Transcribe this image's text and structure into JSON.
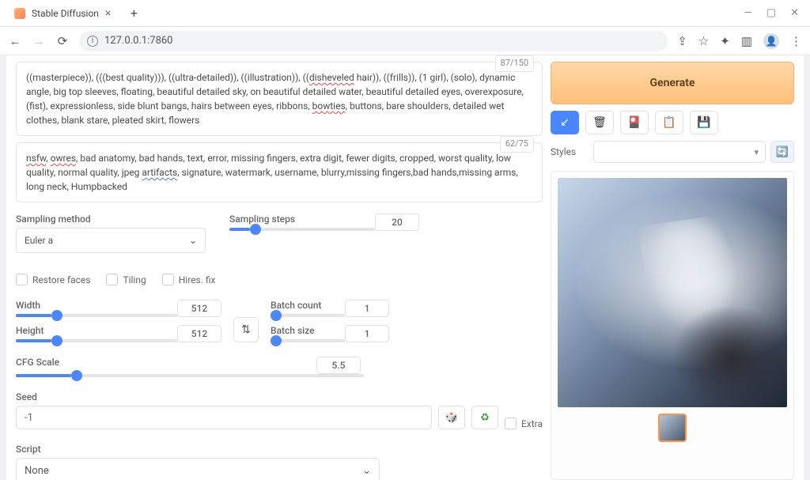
{
  "window": {
    "tab_title": "Stable Diffusion",
    "url": "127.0.0.1:7860"
  },
  "prompt": {
    "counter": "87/150",
    "text_parts": [
      "((masterpiece)), (((best quality))), ((ultra-detailed)), ((illustration)), ((",
      "disheveled",
      " hair)), ((frills)), (1 girl), (solo), dynamic angle, big top sleeves, floating, beautiful detailed sky, on beautiful detailed water, beautiful detailed eyes, overexposure, (fist), expressionless, side blunt bangs, hairs between eyes, ribbons, ",
      "bowties",
      ", buttons, bare shoulders,  detailed wet clothes, blank stare, pleated skirt, flowers"
    ]
  },
  "neg_prompt": {
    "counter": "62/75",
    "text_parts": [
      "nsfw",
      ", ",
      "owres",
      ", bad anatomy, bad hands, text, error, missing fingers, extra digit, fewer digits, cropped, worst quality, low quality, normal quality, jpeg ",
      "artifacts",
      ", signature, watermark, username, blurry,missing fingers,bad hands,missing arms, long neck, Humpbacked"
    ]
  },
  "generate_label": "Generate",
  "styles_label": "Styles",
  "sampling": {
    "method_label": "Sampling method",
    "method_value": "Euler a",
    "steps_label": "Sampling steps",
    "steps_value": "20"
  },
  "checks": {
    "restore_faces": "Restore faces",
    "tiling": "Tiling",
    "hires_fix": "Hires. fix"
  },
  "dims": {
    "width_label": "Width",
    "width_value": "512",
    "height_label": "Height",
    "height_value": "512"
  },
  "batch": {
    "count_label": "Batch count",
    "count_value": "1",
    "size_label": "Batch size",
    "size_value": "1"
  },
  "cfg": {
    "label": "CFG Scale",
    "value": "5.5"
  },
  "seed": {
    "label": "Seed",
    "value": "-1",
    "extra_label": "Extra"
  },
  "script": {
    "label": "Script",
    "value": "None"
  }
}
